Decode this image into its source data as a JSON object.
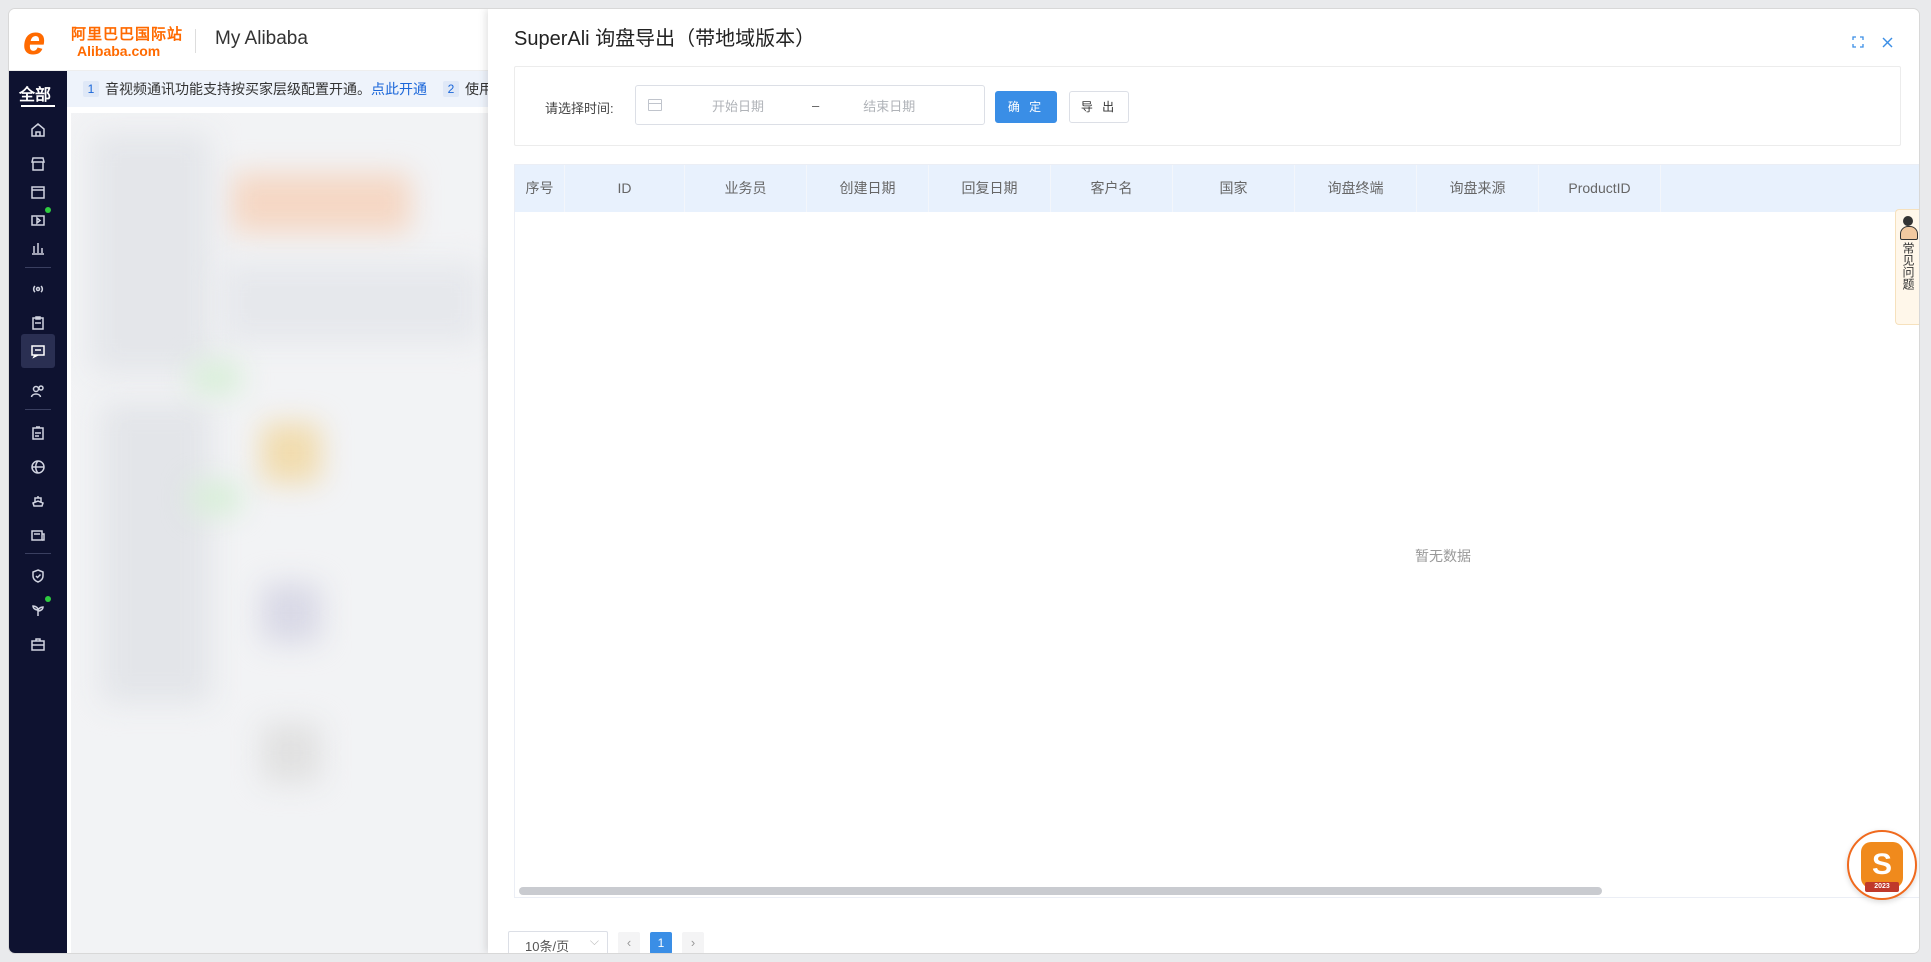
{
  "header": {
    "logo_cn": "阿里巴巴国际站",
    "logo_en": "Alibaba.com",
    "title": "My Alibaba"
  },
  "sidebar": {
    "all_label": "全部",
    "items": [
      {
        "icon": "home-icon"
      },
      {
        "icon": "store-icon"
      },
      {
        "icon": "box-icon"
      },
      {
        "icon": "video-icon"
      },
      {
        "icon": "bar-chart-icon"
      },
      {
        "icon": "broadcast-icon"
      },
      {
        "icon": "clipboard-icon"
      },
      {
        "icon": "message-icon"
      },
      {
        "icon": "users-icon"
      },
      {
        "icon": "document-icon"
      },
      {
        "icon": "globe-icon"
      },
      {
        "icon": "ship-icon"
      },
      {
        "icon": "finance-icon"
      },
      {
        "icon": "shield-icon"
      },
      {
        "icon": "sprout-icon"
      },
      {
        "icon": "toolbox-icon"
      }
    ]
  },
  "notice": {
    "num1": "1",
    "text1": "音视频通讯功能支持按买家层级配置开通。",
    "link1": "点此开通",
    "num2": "2",
    "text2": "使用"
  },
  "drawer": {
    "title": "SuperAli 询盘导出（带地域版本）",
    "filter": {
      "label": "请选择时间:",
      "start_placeholder": "开始日期",
      "separator": "–",
      "end_placeholder": "结束日期",
      "confirm_label": "确 定",
      "export_label": "导 出"
    },
    "table": {
      "columns": [
        "序号",
        "ID",
        "业务员",
        "创建日期",
        "回复日期",
        "客户名",
        "国家",
        "询盘终端",
        "询盘来源",
        "ProductID"
      ],
      "empty_text": "暂无数据"
    },
    "pagination": {
      "page_size": "10条/页",
      "prev": "‹",
      "current": "1",
      "next": "›"
    }
  },
  "faq": {
    "label": "常见问题"
  },
  "app_float": {
    "letter": "S",
    "year": "2023"
  },
  "colors": {
    "brand_orange": "#ff6a00",
    "primary_blue": "#3a8ee6",
    "sidebar_bg": "#0e1230",
    "table_header_bg": "#e8f1fd"
  }
}
